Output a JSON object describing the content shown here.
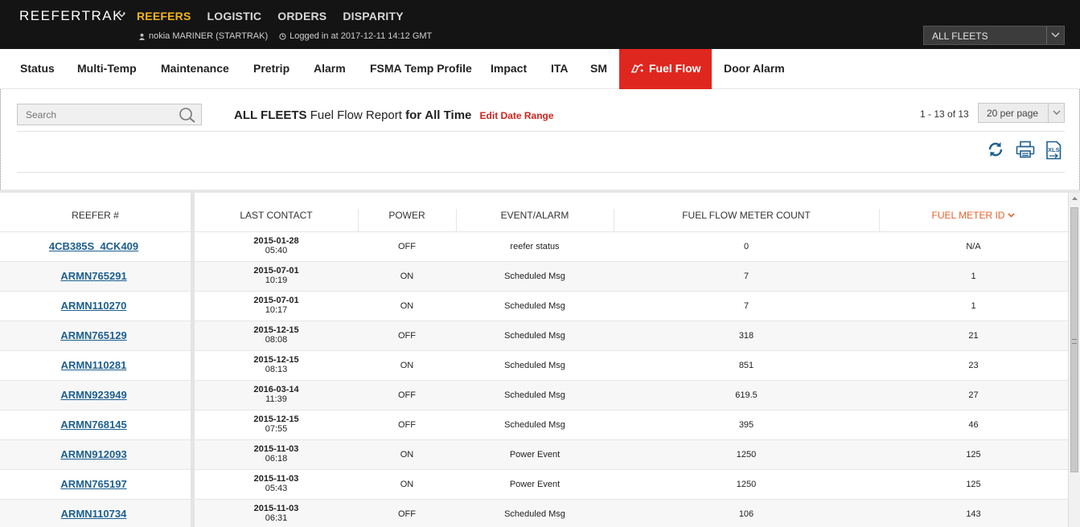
{
  "header": {
    "logo": "REEFERTRAK",
    "logo_mark": "•",
    "nav": [
      "REEFERS",
      "LOGISTIC",
      "ORDERS",
      "DISPARITY"
    ],
    "active_nav": "REEFERS",
    "user": "nokia MARINER (STARTRAK)",
    "login": "Logged in at 2017-12-11 14:12 GMT",
    "fleet_select": "ALL FLEETS",
    "accent_color": "#f2b51d"
  },
  "tabs": [
    "Status",
    "Multi-Temp",
    "Maintenance",
    "Pretrip",
    "Alarm",
    "FSMA Temp Profile",
    "Impact",
    "ITA",
    "SM",
    "Fuel Flow",
    "Door Alarm"
  ],
  "active_tab": "Fuel Flow",
  "active_tab_color": "#e0271f",
  "report": {
    "search_placeholder": "Search",
    "fleet": "ALL FLEETS",
    "name": "Fuel Flow Report",
    "for": "for",
    "period": "All Time",
    "edit_link": "Edit Date Range",
    "pager_text": "1 - 13 of 13",
    "per_page": "20 per page",
    "tools": [
      "refresh-icon",
      "print-icon",
      "xls-export-icon"
    ]
  },
  "table": {
    "columns": [
      "REEFER #",
      "LAST CONTACT",
      "POWER",
      "EVENT/ALARM",
      "FUEL FLOW METER COUNT",
      "FUEL METER ID"
    ],
    "sorted_column": "FUEL METER ID",
    "sort_color": "#e8622a",
    "rows": [
      {
        "reefer": "4CB385S_4CK409",
        "date": "2015-01-28",
        "time": "05:40",
        "power": "OFF",
        "event": "reefer status",
        "count": "0",
        "meter_id": "N/A"
      },
      {
        "reefer": "ARMN765291",
        "date": "2015-07-01",
        "time": "10:19",
        "power": "ON",
        "event": "Scheduled Msg",
        "count": "7",
        "meter_id": "1"
      },
      {
        "reefer": "ARMN110270",
        "date": "2015-07-01",
        "time": "10:17",
        "power": "ON",
        "event": "Scheduled Msg",
        "count": "7",
        "meter_id": "1"
      },
      {
        "reefer": "ARMN765129",
        "date": "2015-12-15",
        "time": "08:08",
        "power": "OFF",
        "event": "Scheduled Msg",
        "count": "318",
        "meter_id": "21"
      },
      {
        "reefer": "ARMN110281",
        "date": "2015-12-15",
        "time": "08:13",
        "power": "ON",
        "event": "Scheduled Msg",
        "count": "851",
        "meter_id": "23"
      },
      {
        "reefer": "ARMN923949",
        "date": "2016-03-14",
        "time": "11:39",
        "power": "OFF",
        "event": "Scheduled Msg",
        "count": "619.5",
        "meter_id": "27"
      },
      {
        "reefer": "ARMN768145",
        "date": "2015-12-15",
        "time": "07:55",
        "power": "OFF",
        "event": "Scheduled Msg",
        "count": "395",
        "meter_id": "46"
      },
      {
        "reefer": "ARMN912093",
        "date": "2015-11-03",
        "time": "06:18",
        "power": "ON",
        "event": "Power Event",
        "count": "1250",
        "meter_id": "125"
      },
      {
        "reefer": "ARMN765197",
        "date": "2015-11-03",
        "time": "05:43",
        "power": "ON",
        "event": "Power Event",
        "count": "1250",
        "meter_id": "125"
      },
      {
        "reefer": "ARMN110734",
        "date": "2015-11-03",
        "time": "06:31",
        "power": "OFF",
        "event": "Scheduled Msg",
        "count": "106",
        "meter_id": "143"
      }
    ]
  }
}
